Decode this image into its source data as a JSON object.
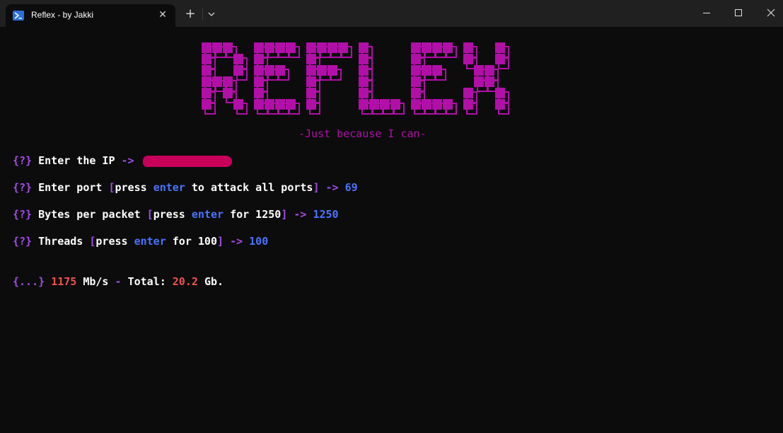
{
  "window": {
    "tab_title": "Reflex - by Jakki",
    "icons": [
      "powershell-icon",
      "close-icon",
      "plus-icon",
      "chevron-down-icon",
      "minimize-icon",
      "maximize-icon",
      "window-close-icon"
    ]
  },
  "banner": {
    "logo_text": "REFLEX",
    "tagline": "-Just because I can-",
    "color": "#b10fa8"
  },
  "prompts": [
    {
      "marker": "{?}",
      "label": "Enter the IP",
      "arrow": "->",
      "value": ""
    },
    {
      "marker": "{?}",
      "label": "Enter port",
      "hint_open": "[",
      "hint_press": "press",
      "hint_enter": "enter",
      "hint_rest": "to attack all ports",
      "hint_close": "]",
      "arrow": "->",
      "value": "69"
    },
    {
      "marker": "{?}",
      "label": "Bytes per packet",
      "hint_open": "[",
      "hint_press": "press",
      "hint_enter": "enter",
      "hint_rest": "for 1250",
      "hint_close": "]",
      "arrow": "->",
      "value": "1250"
    },
    {
      "marker": "{?}",
      "label": "Threads",
      "hint_open": "[",
      "hint_press": "press",
      "hint_enter": "enter",
      "hint_rest": "for 100",
      "hint_close": "]",
      "arrow": "->",
      "value": "100"
    }
  ],
  "status": {
    "marker": "{...}",
    "rate_value": "1175",
    "rate_unit": "Mb/s",
    "dash": "-",
    "total_label": "Total:",
    "total_value": "20.2",
    "total_unit": "Gb."
  },
  "colors": {
    "background": "#0c0c0c",
    "accent_purple": "#a24de8",
    "accent_blue": "#4b73ff",
    "accent_red": "#ef5350",
    "logo_magenta": "#b10fa8"
  }
}
